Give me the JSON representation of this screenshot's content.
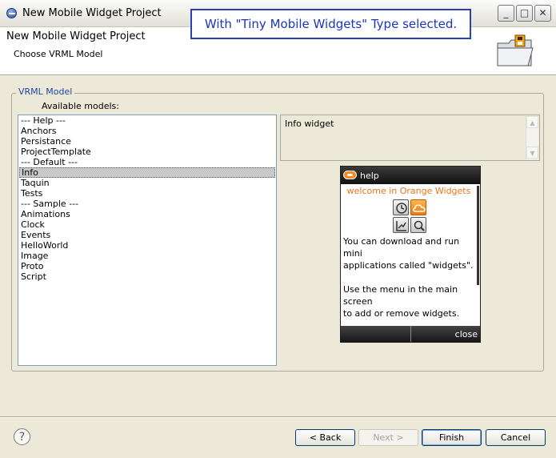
{
  "window": {
    "title": "New Mobile Widget Project",
    "minimize": "_",
    "maximize": "□",
    "close": "✕"
  },
  "annotation": "With \"Tiny Mobile Widgets\" Type selected.",
  "header": {
    "title": "New Mobile Widget Project",
    "subtitle": "Choose VRML Model",
    "icon": "folder-wizard-icon"
  },
  "group": {
    "title": "VRML Model",
    "available_label": "Available models:",
    "models": [
      "--- Help ---",
      "Anchors",
      "Persistance",
      "ProjectTemplate",
      "--- Default ---",
      "Info",
      "Taquin",
      "Tests",
      "--- Sample ---",
      "Animations",
      "Clock",
      "Events",
      "HelloWorld",
      "Image",
      "Proto",
      "Script"
    ],
    "selected_model": "Info",
    "description": "Info widget"
  },
  "preview": {
    "header": "help",
    "welcome": "welcome in Orange Widgets",
    "icons": [
      "clock-icon",
      "cloud-icon",
      "chart-icon",
      "search-icon"
    ],
    "selected_icon": "cloud-icon",
    "body": "You can download and run mini\napplications called \"widgets\".\n\nUse the menu in the main screen\nto add or remove widgets.\n\nThe left and right keys select a\nwidget.",
    "close": "close"
  },
  "footer": {
    "help": "?",
    "back": "< Back",
    "next": "Next >",
    "finish": "Finish",
    "cancel": "Cancel"
  }
}
